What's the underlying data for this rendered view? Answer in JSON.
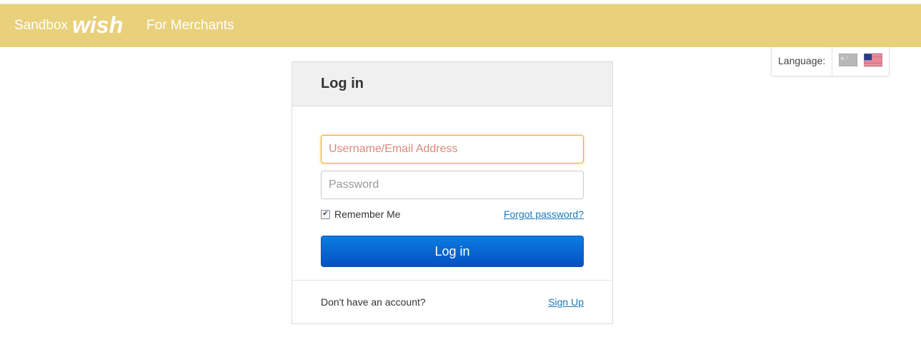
{
  "header": {
    "sandbox_label": "Sandbox",
    "logo_text": "wish",
    "merchants_label": "For Merchants",
    "bg_color": "#e9d07a"
  },
  "language": {
    "label": "Language:",
    "options": [
      {
        "name": "china-flag-icon",
        "selected": false
      },
      {
        "name": "us-flag-icon",
        "selected": true
      }
    ]
  },
  "login": {
    "title": "Log in",
    "username_placeholder": "Username/Email Address",
    "username_value": "",
    "password_placeholder": "Password",
    "password_value": "",
    "remember_label": "Remember Me",
    "remember_checked": true,
    "forgot_label": "Forgot password?",
    "submit_label": "Log in",
    "accent_color": "#0650c4"
  },
  "footer": {
    "no_account_text": "Don't have an account?",
    "signup_label": "Sign Up"
  }
}
